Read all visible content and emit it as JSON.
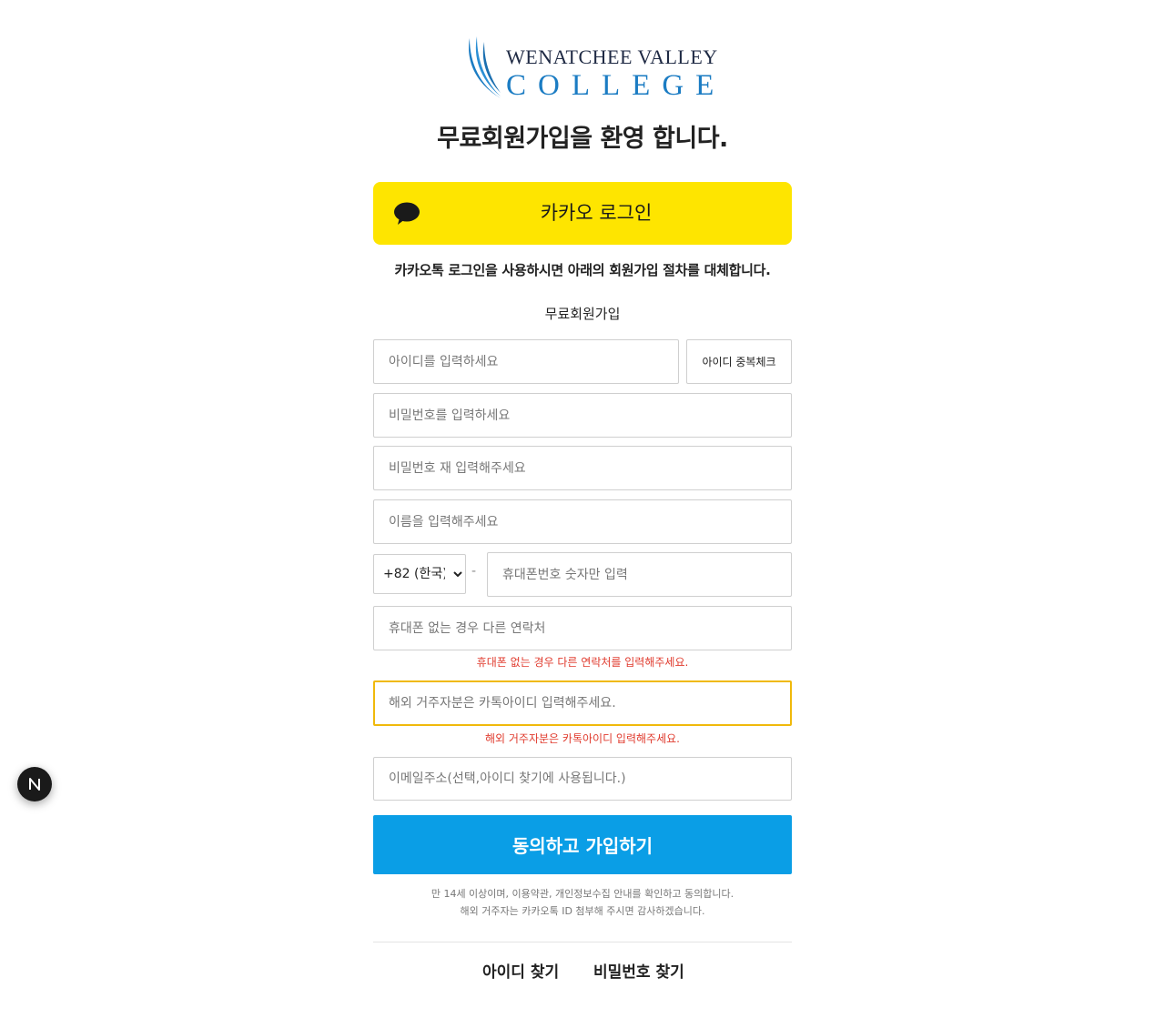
{
  "logo": {
    "line1": "WENATCHEE VALLEY",
    "line2": "COLLEGE"
  },
  "headline": "무료회원가입을 환영 합니다.",
  "kakao": {
    "button_label": "카카오 로그인",
    "icon": "speech-bubble-icon",
    "note": "카카오톡 로그인을 사용하시면 아래의 회원가입 절차를 대체합니다."
  },
  "form": {
    "title": "무료회원가입",
    "id_placeholder": "아이디를 입력하세요",
    "id_check_label": "아이디 중복체크",
    "password_placeholder": "비밀번호를 입력하세요",
    "password_confirm_placeholder": "비밀번호 재 입력해주세요",
    "name_placeholder": "이름을 입력해주세요",
    "country_code": "+82 (한국)",
    "phone_separator": "-",
    "phone_placeholder": "휴대폰번호 숫자만 입력",
    "alt_contact_placeholder": "휴대폰 없는 경우 다른 연락처",
    "alt_contact_error": "휴대폰 없는 경우 다른 연락처를 입력해주세요.",
    "kakao_id_placeholder": "해외 거주자분은 카톡아이디 입력해주세요.",
    "kakao_id_error": "해외 거주자분은 카톡아이디 입력해주세요.",
    "email_placeholder": "이메일주소(선택,아이디 찾기에 사용됩니다.)",
    "submit_label": "동의하고 가입하기",
    "terms_line1": "만 14세 이상이며, 이용약관, 개인정보수집 안내를 확인하고 동의합니다.",
    "terms_line2": "해외 거주자는 카카오톡 ID 첨부해 주시면 감사하겠습니다."
  },
  "links": {
    "find_id": "아이디 찾기",
    "find_password": "비밀번호 찾기"
  },
  "badge": {
    "icon": "n-logo-icon"
  },
  "colors": {
    "kakao_yellow": "#fee500",
    "submit_blue": "#0a9ee6",
    "error_red": "#e03b2e",
    "focus_border": "#f0b90b",
    "logo_blue": "#1b7cc3"
  }
}
